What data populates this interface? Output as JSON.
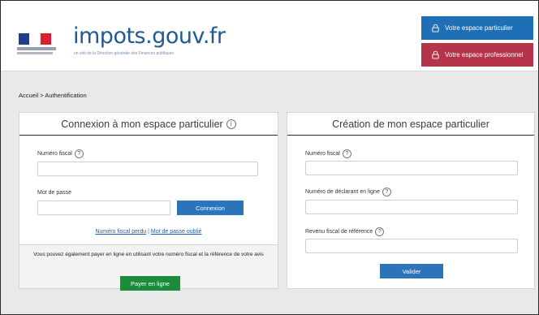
{
  "header": {
    "logo_text": "impots.gouv.fr",
    "logo_subtitle": "un site de la Direction générale des Finances publiques",
    "flag_colors": [
      "#1f3f8f",
      "#ffffff",
      "#d8202f"
    ],
    "btn_particulier": "Votre espace particulier",
    "btn_professionnel": "Votre espace professionnel",
    "icon_particulier": "lock-icon",
    "icon_professionnel": "lock-icon"
  },
  "breadcrumb": {
    "home": "Accueil",
    "separator": ">",
    "current": "Authentification"
  },
  "login": {
    "title": "Connexion à mon espace particulier",
    "fiscal_label": "Numéro fiscal",
    "fiscal_value": "",
    "password_label": "Mot de passe",
    "password_value": "",
    "connect_button": "Connexion",
    "link_lost_number": "Numéro fiscal perdu",
    "link_separator": "|",
    "link_forgot_password": "Mot de passe oublié"
  },
  "payment": {
    "text": "Vous pouvez également payer en ligne en utilisant votre numéro fiscal et la référence de votre avis",
    "button": "Payer en ligne"
  },
  "creation": {
    "title": "Création de mon espace particulier",
    "fiscal_label": "Numéro fiscal",
    "fiscal_value": "",
    "declarant_label": "Numéro de déclarant en ligne",
    "declarant_value": "",
    "revenu_label": "Revenu fiscal de référence",
    "revenu_value": "",
    "validate_button": "Valider"
  },
  "colors": {
    "brand_blue": "#1f6fb7",
    "brand_red": "#b5344a",
    "action_blue": "#2b73ba",
    "pay_green": "#1e8a3c"
  }
}
